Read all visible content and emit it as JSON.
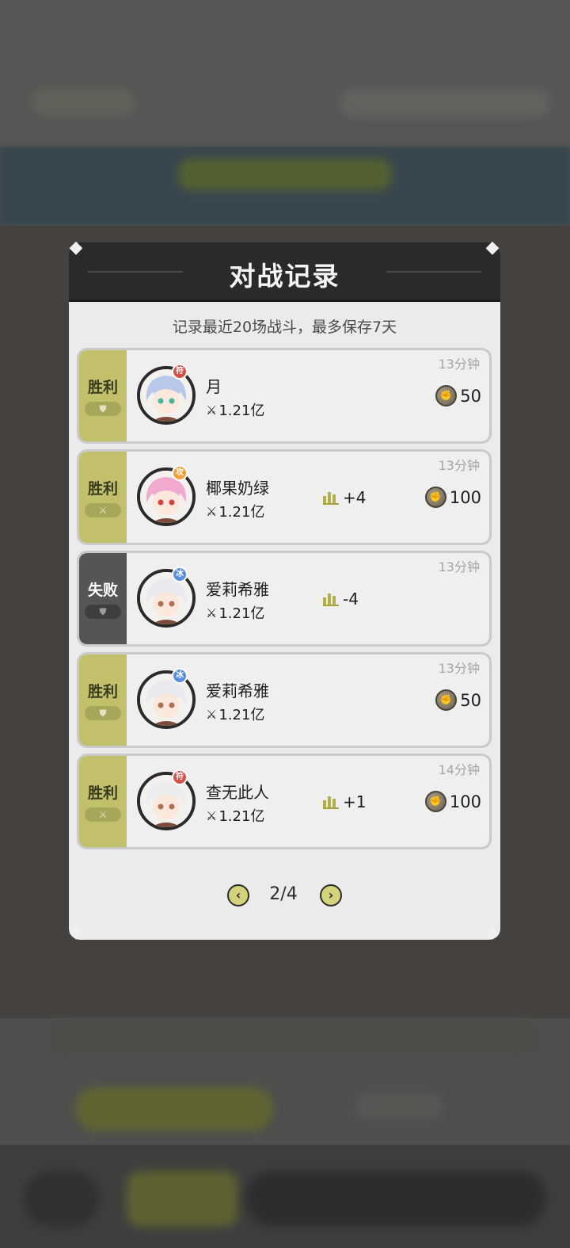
{
  "dialog": {
    "title": "对战记录",
    "subtitle": "记录最近20场战斗，最多保存7天"
  },
  "records": [
    {
      "result": "胜利",
      "outcome": "win",
      "mode_icon": "shield-icon",
      "name": "月",
      "power": "1.21亿",
      "time": "13分钟",
      "rank_change": "",
      "reward": "50",
      "badge": "符",
      "badge_color": "#d8504a",
      "avatar_hair": "#b9c8ea",
      "avatar_eye": "#3fb89a"
    },
    {
      "result": "胜利",
      "outcome": "win",
      "mode_icon": "sword-icon",
      "name": "椰果奶绿",
      "power": "1.21亿",
      "time": "13分钟",
      "rank_change": "+4",
      "reward": "100",
      "badge": "攻",
      "badge_color": "#f0a03a",
      "avatar_hair": "#f2a9cf",
      "avatar_eye": "#d8403a"
    },
    {
      "result": "失败",
      "outcome": "lose",
      "mode_icon": "shield-icon",
      "name": "爱莉希雅",
      "power": "1.21亿",
      "time": "13分钟",
      "rank_change": "-4",
      "reward": "",
      "badge": "冰",
      "badge_color": "#5a8ee0",
      "avatar_hair": "#e9e9ee",
      "avatar_eye": "#b07050"
    },
    {
      "result": "胜利",
      "outcome": "win",
      "mode_icon": "shield-icon",
      "name": "爱莉希雅",
      "power": "1.21亿",
      "time": "13分钟",
      "rank_change": "",
      "reward": "50",
      "badge": "冰",
      "badge_color": "#5a8ee0",
      "avatar_hair": "#e9e9ee",
      "avatar_eye": "#b07050"
    },
    {
      "result": "胜利",
      "outcome": "win",
      "mode_icon": "sword-icon",
      "name": "查无此人",
      "power": "1.21亿",
      "time": "14分钟",
      "rank_change": "+1",
      "reward": "100",
      "badge": "符",
      "badge_color": "#d8504a",
      "avatar_hair": "#ececec",
      "avatar_eye": "#b07050"
    }
  ],
  "pager": {
    "current": "2/4",
    "prev_icon": "chevron-left-icon",
    "next_icon": "chevron-right-icon"
  },
  "icons": {
    "power": "crossed-swords-icon",
    "rank": "bar-chart-icon",
    "reward": "fist-coin-icon"
  },
  "colors": {
    "win": "#c2c06a",
    "lose": "#555555",
    "header": "#2a2a2a",
    "accent": "#d4d27a"
  }
}
